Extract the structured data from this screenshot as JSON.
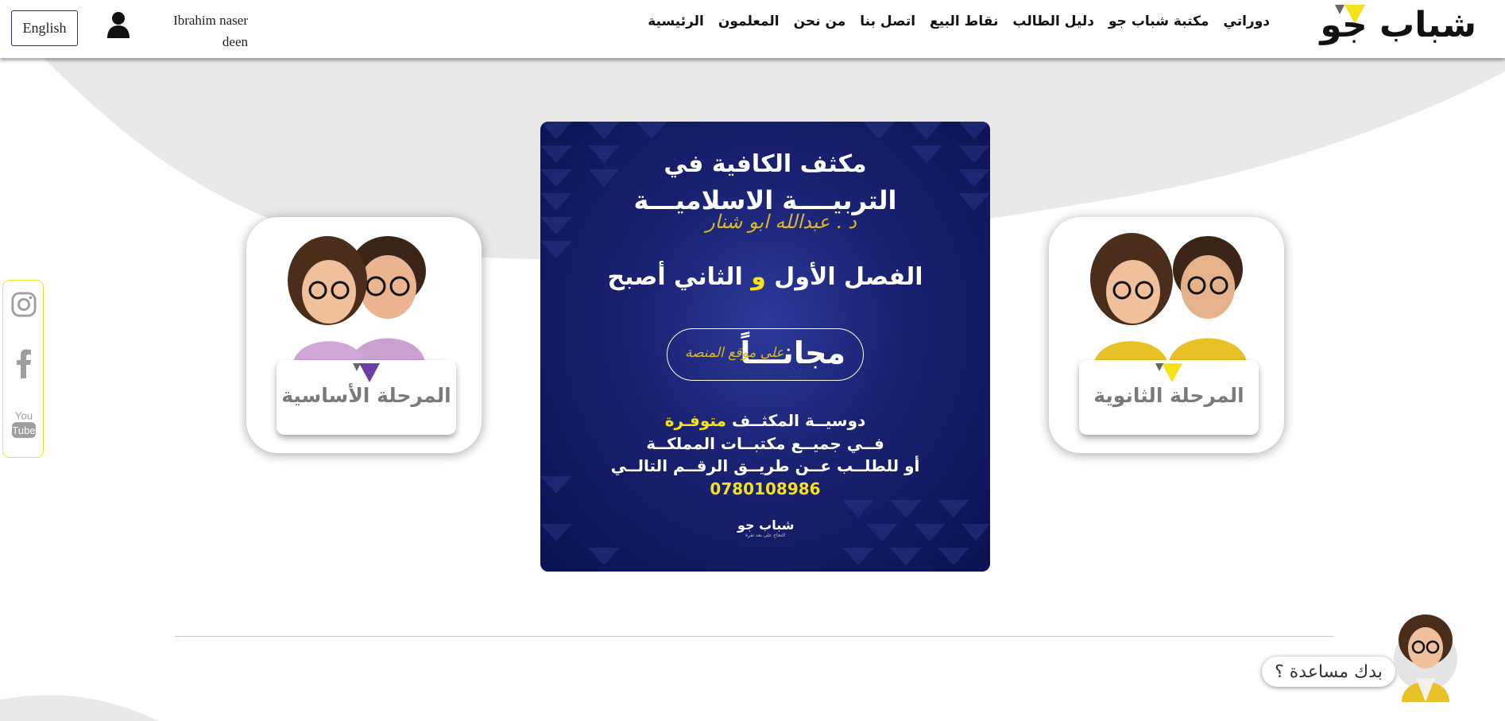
{
  "header": {
    "logo_text": "شباب جو",
    "nav": [
      {
        "label": "الرئيسية"
      },
      {
        "label": "المعلمون"
      },
      {
        "label": "من نحن"
      },
      {
        "label": "اتصل بنا"
      },
      {
        "label": "نقاط البيع"
      },
      {
        "label": "دليل الطالب"
      },
      {
        "label": "مكتبة شباب جو"
      },
      {
        "label": "دوراتي"
      }
    ],
    "user_name_line1": "Ibrahim naser",
    "user_name_line2": "deen",
    "user_icon": "user-icon",
    "language_button": "English"
  },
  "social": {
    "items": [
      {
        "icon": "instagram-icon"
      },
      {
        "icon": "facebook-icon"
      },
      {
        "icon": "youtube-icon",
        "text_top": "You",
        "text_bottom": "Tube"
      }
    ]
  },
  "stages": {
    "secondary": {
      "label": "المرحلة الثانوية",
      "accent": "#f5e21a"
    },
    "basic": {
      "label": "المرحلة الأساسية",
      "accent": "#6b3fa0"
    }
  },
  "poster": {
    "line1": "مكثف الكافية في",
    "line2": "التربيــــة الاسلاميـــة",
    "author": "د . عبدالله ابو شنار",
    "line3_a": "الفصل الأول",
    "line3_and": "و",
    "line3_b": "الثاني أصبح",
    "free_big": "مجانـــاً",
    "free_small": "على موقع المنصة",
    "dossier_a": "دوسيــة المكثــف",
    "dossier_b": "متوفـرة",
    "line_stores": "فــي جميــع مكتبــات المملكــة",
    "line_order": "أو للطلــب عــن طريــق الرقــم التالــي",
    "phone": "0780108986",
    "logo_name": "شباب جو",
    "logo_sub": "النجاح على بعد نقرة"
  },
  "help": {
    "text": "بدك مساعدة ؟"
  },
  "colors": {
    "accent_yellow": "#f5e21a",
    "poster_navy": "#131a63",
    "purple": "#6b3fa0"
  }
}
